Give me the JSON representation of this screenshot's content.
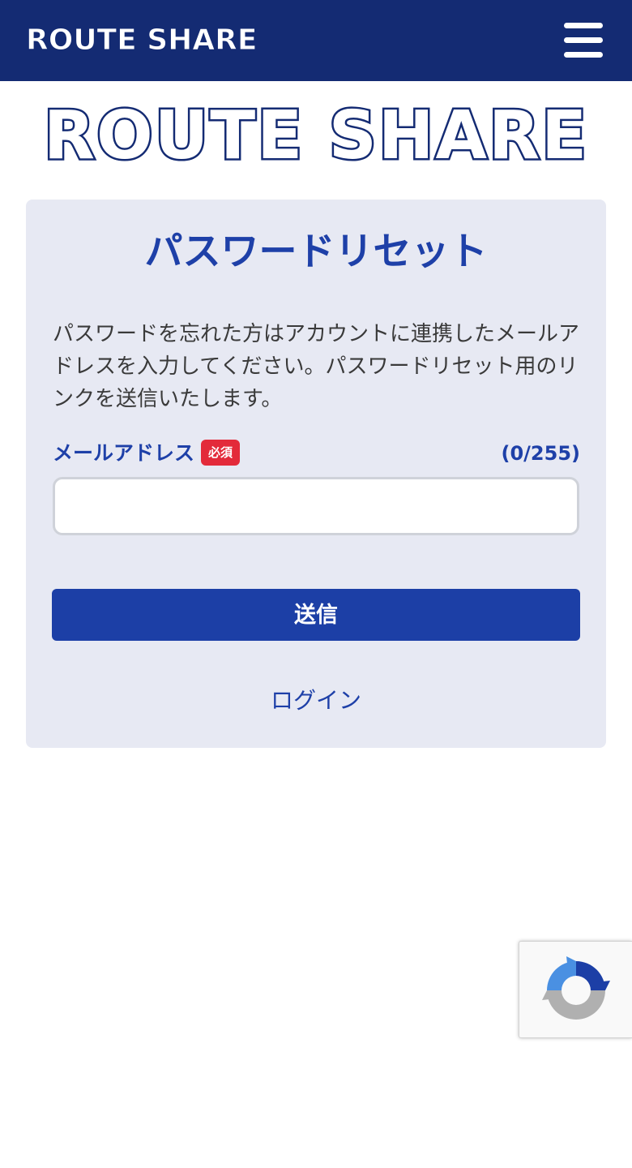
{
  "header": {
    "logo_text": "ROUTE SHARE",
    "menu_icon": "hamburger-menu-icon",
    "background_color": "#142b73"
  },
  "main_logo": {
    "text": "ROUTE SHARE"
  },
  "card": {
    "title": "パスワードリセット",
    "description": "パスワードを忘れた方はアカウントに連携したメールアドレスを入力してください。パスワードリセット用のリンクを送信いたします。",
    "email_field": {
      "label": "メールアドレス",
      "required_badge": "必須",
      "counter": "(0/255)",
      "value": "",
      "placeholder": ""
    },
    "submit_label": "送信",
    "login_link": "ログイン"
  },
  "colors": {
    "brand_blue": "#1e40a8",
    "button_blue": "#1c3fa6",
    "card_background": "#e7e9f3",
    "required_red": "#e32a3a"
  },
  "recaptcha": {
    "icon": "recaptcha-icon"
  }
}
